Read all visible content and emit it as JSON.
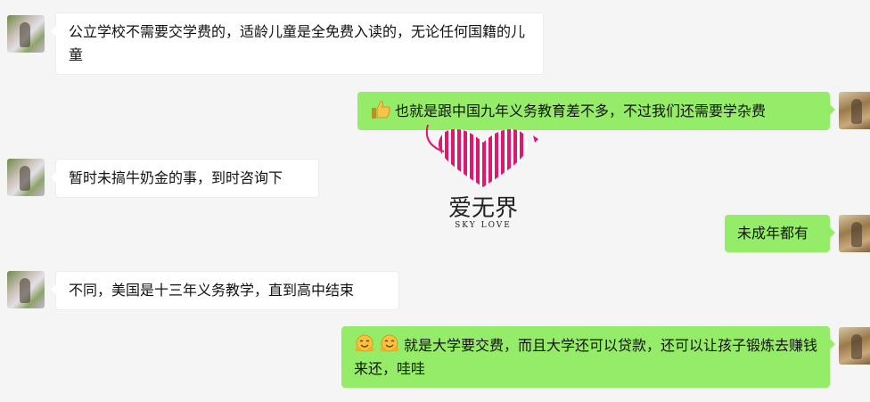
{
  "chat": {
    "messages": [
      {
        "side": "in",
        "text": "公立学校不需要交学费的，适龄儿童是全免费入读的，无论任何国籍的儿童"
      },
      {
        "side": "out",
        "emoji": [
          "thumbs-up"
        ],
        "text": "也就是跟中国九年义务教育差不多，不过我们还需要学杂费"
      },
      {
        "side": "in",
        "text": "暂时未搞牛奶金的事，到时咨询下"
      },
      {
        "side": "out",
        "text": "未成年都有"
      },
      {
        "side": "in",
        "text": "不同，美国是十三年义务教学，直到高中结束"
      },
      {
        "side": "out",
        "emoji": [
          "hug-face",
          "hug-face"
        ],
        "text": "就是大学要交费，而且大学还可以贷款，还可以让孩子锻炼去赚钱来还，哇哇"
      }
    ]
  },
  "watermark": {
    "title": "爱无界",
    "subtitle": "SKY LOVE",
    "color": "#e0166f"
  },
  "colors": {
    "background": "#f5f5f5",
    "incoming_bubble": "#ffffff",
    "outgoing_bubble": "#95ec69"
  }
}
